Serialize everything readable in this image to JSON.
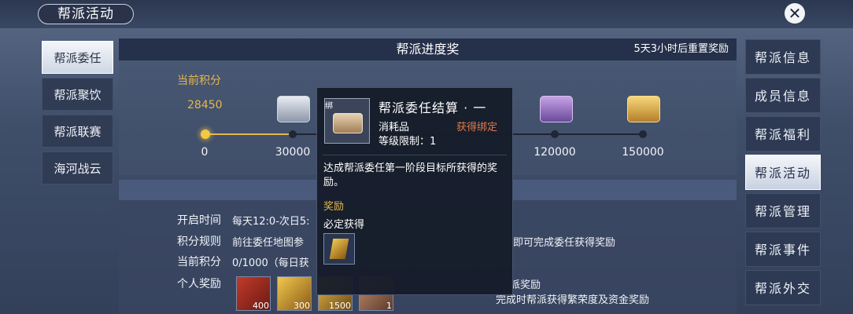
{
  "header": {
    "title": "帮派活动",
    "close_icon": "close-icon"
  },
  "left_tabs": [
    {
      "label": "帮派委任",
      "active": true
    },
    {
      "label": "帮派聚饮",
      "active": false
    },
    {
      "label": "帮派联赛",
      "active": false
    },
    {
      "label": "海河战云",
      "active": false
    }
  ],
  "right_tabs": [
    {
      "label": "帮派信息",
      "active": false
    },
    {
      "label": "成员信息",
      "active": false
    },
    {
      "label": "帮派福利",
      "active": false
    },
    {
      "label": "帮派活动",
      "active": true
    },
    {
      "label": "帮派管理",
      "active": false
    },
    {
      "label": "帮派事件",
      "active": false
    },
    {
      "label": "帮派外交",
      "active": false
    }
  ],
  "progress": {
    "title": "帮派进度奖",
    "reset_text": "5天3小时后重置奖励",
    "current_label": "当前积分",
    "current_value": "28450",
    "current_fraction": 0.19,
    "milestones": [
      "0",
      "30000",
      "120000",
      "150000"
    ]
  },
  "details": {
    "open_time_label": "开启时间",
    "open_time_value": "每天12:0-次日5:",
    "rule_label": "积分规则",
    "rule_value_left": "前往委任地图参",
    "rule_value_right": "即可完成委任获得奖励",
    "score_label": "当前积分",
    "score_value": "0/1000（每日获",
    "personal_label": "个人奖励",
    "personal_rewards": [
      {
        "count": "400",
        "icon": "red-envelope-icon"
      },
      {
        "count": "300",
        "icon": "gold-coin-icon"
      },
      {
        "count": "1500",
        "icon": "gold-ticket-icon"
      },
      {
        "count": "1",
        "icon": "chest-icon"
      }
    ],
    "guild_reward_label": "派奖励",
    "guild_reward_text": "完成时帮派获得繁荣度及资金奖励"
  },
  "tooltip": {
    "bind_tag": "绑",
    "title": "帮派委任结算 · 一",
    "type": "消耗品",
    "level": "等级限制：1",
    "acquire": "获得绑定",
    "desc": "达成帮派委任第一阶段目标所获得的奖励。",
    "reward_heading": "奖励",
    "must_get": "必定获得",
    "reward_icon": "gold-ticket-icon"
  },
  "colors": {
    "accent_gold": "#e5b84e",
    "acquire_orange": "#e07a4a"
  }
}
